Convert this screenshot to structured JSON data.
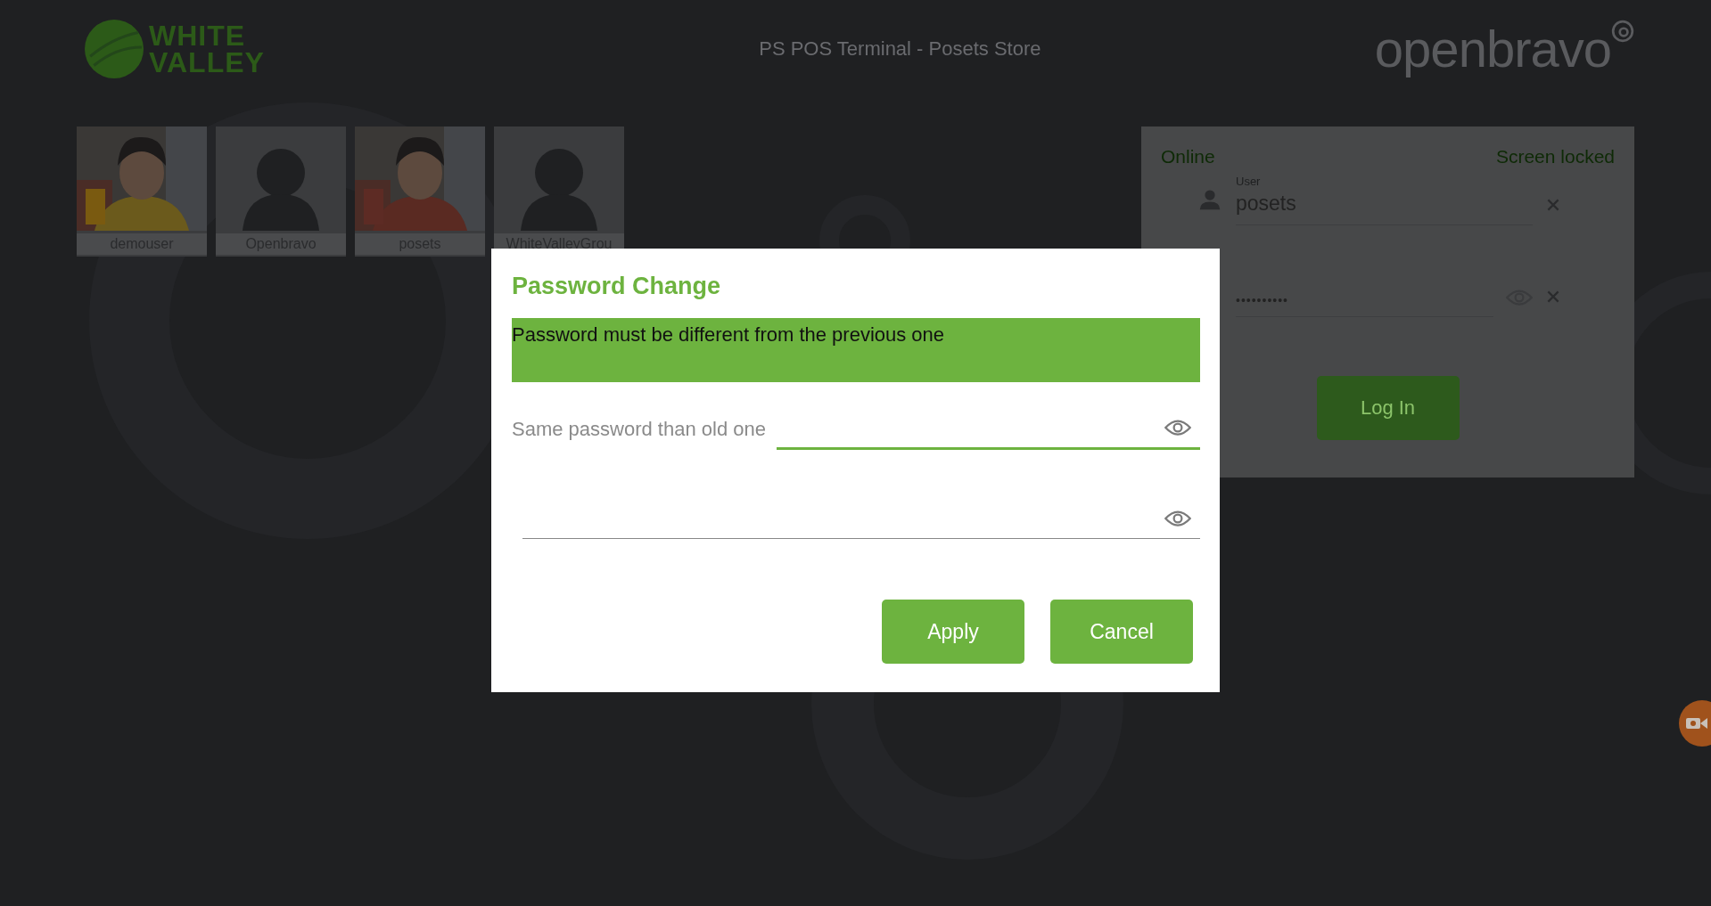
{
  "header": {
    "logo_lines": [
      "WHITE",
      "VALLEY"
    ],
    "title": "PS POS Terminal - Posets Store",
    "brand": "openbravo"
  },
  "users": [
    {
      "name": "demouser",
      "kind": "picture"
    },
    {
      "name": "Openbravo",
      "kind": "silhouette"
    },
    {
      "name": "posets",
      "kind": "picture"
    },
    {
      "name": "WhiteValleyGrou",
      "kind": "silhouette"
    }
  ],
  "login": {
    "connection": "Online",
    "status": "Screen locked",
    "user_label": "User",
    "user_value": "posets",
    "password_value": "••••••••••",
    "button": "Log In"
  },
  "dialog": {
    "title": "Password Change",
    "message": "Password must be different from the previous one",
    "fields": [
      {
        "label": "Same password than old one",
        "focused": true
      },
      {
        "focused": false
      }
    ],
    "buttons": [
      "Apply",
      "Cancel"
    ]
  }
}
